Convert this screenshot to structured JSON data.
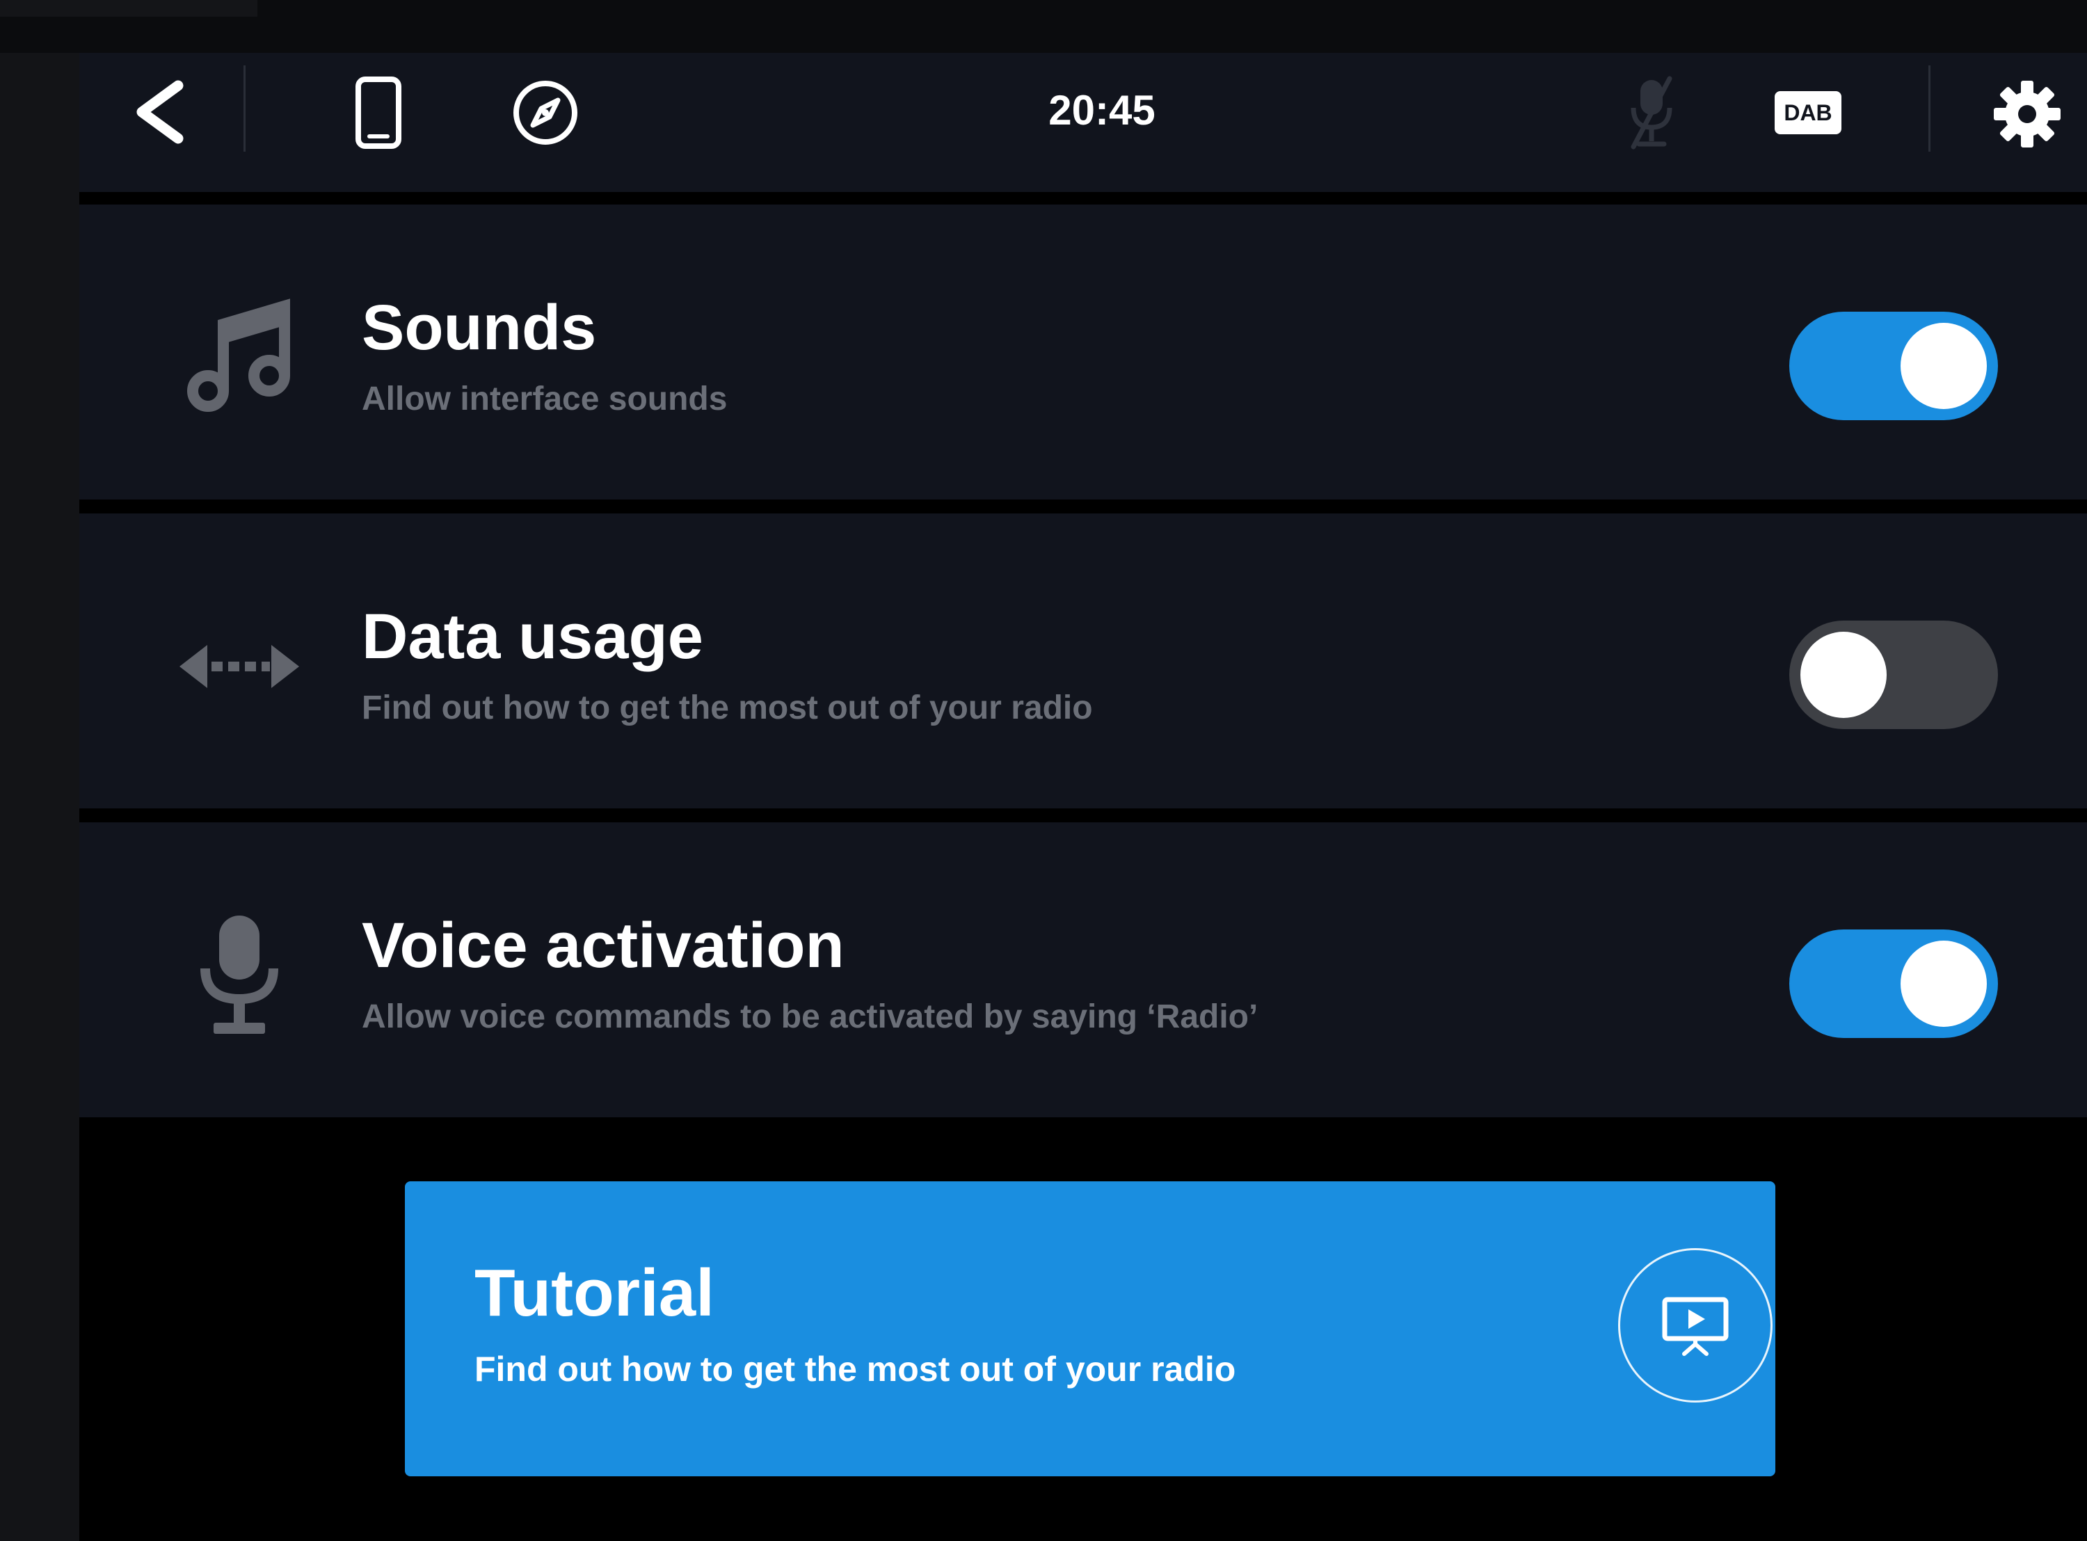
{
  "header": {
    "time": "20:45",
    "dab_label": "DAB",
    "icons": [
      "back-icon",
      "phone-icon",
      "compass-icon",
      "mic-muted-icon",
      "dab-icon",
      "gear-icon"
    ]
  },
  "settings": [
    {
      "title": "Sounds",
      "subtitle": "Allow interface sounds",
      "icon": "music-note-icon",
      "enabled": true
    },
    {
      "title": "Data usage",
      "subtitle": "Find out how to get the most out of your radio",
      "icon": "data-arrows-icon",
      "enabled": false
    },
    {
      "title": "Voice activation",
      "subtitle": "Allow voice commands to be activated by saying ‘Radio’",
      "icon": "microphone-icon",
      "enabled": true
    }
  ],
  "tutorial": {
    "title": "Tutorial",
    "subtitle": "Find out how to get the most out of your radio",
    "icon": "presentation-play-icon"
  },
  "colors": {
    "accent": "#1a8ee0",
    "panel": "#11141d",
    "toggle_off": "#3e4045",
    "subtitle": "#6b6f78"
  }
}
